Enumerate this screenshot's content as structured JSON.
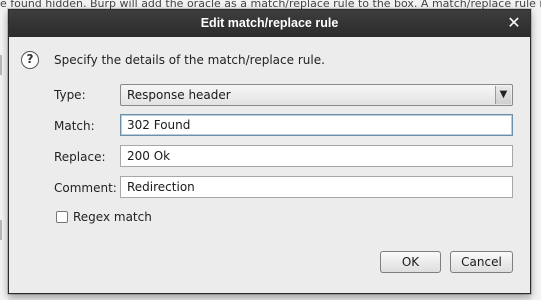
{
  "background": {
    "text": "e found hidden. Burp will add the oracle as a match/replace rule to the box. A match/replace rule is used in the host list to rewrite responses"
  },
  "dialog": {
    "title": "Edit match/replace rule",
    "intro": "Specify the details of the match/replace rule.",
    "type_label": "Type:",
    "type_value": "Response header",
    "match_label": "Match:",
    "match_value": "302 Found",
    "replace_label": "Replace:",
    "replace_value": "200 Ok",
    "comment_label": "Comment:",
    "comment_value": "Redirection",
    "regex_label": "Regex match",
    "regex_checked": false,
    "ok_label": "OK",
    "cancel_label": "Cancel"
  },
  "icons": {
    "help": "question-circle-icon",
    "close": "close-icon",
    "dropdown": "chevron-down-icon"
  }
}
